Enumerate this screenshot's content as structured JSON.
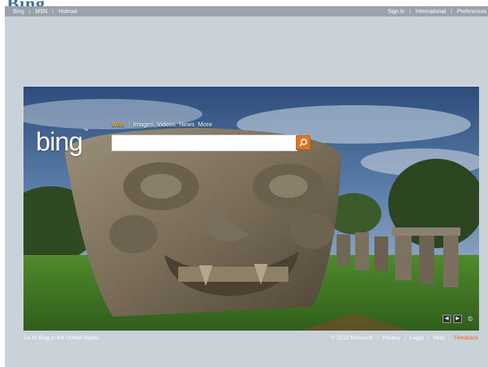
{
  "top_logo_fragment": "Bing",
  "topbar": {
    "left_links": [
      "Bing",
      "MSN",
      "Hotmail"
    ],
    "right_links": [
      "Sign in",
      "International",
      "Preferences"
    ]
  },
  "logo": {
    "text": "bing",
    "tm": "™"
  },
  "nav": {
    "tabs": [
      "Web",
      "Images",
      "Videos",
      "News",
      "More"
    ],
    "active": "Web"
  },
  "search": {
    "value": "",
    "placeholder": ""
  },
  "hero_controls": {
    "prev_icon": "prev-arrow-icon",
    "next_icon": "next-arrow-icon",
    "info_icon": "copyright-icon",
    "info_glyph": "©"
  },
  "footer": {
    "left_link": "Go to Bing in the United States",
    "copyright": "© 2010 Microsoft",
    "links": [
      "Privacy",
      "Legal",
      "Help"
    ],
    "feedback": "Feedback"
  },
  "colors": {
    "accent": "#e8731e",
    "active_tab": "#f5a623",
    "topbar": "#9aa3ab",
    "page_bg": "#c8d0d8"
  }
}
